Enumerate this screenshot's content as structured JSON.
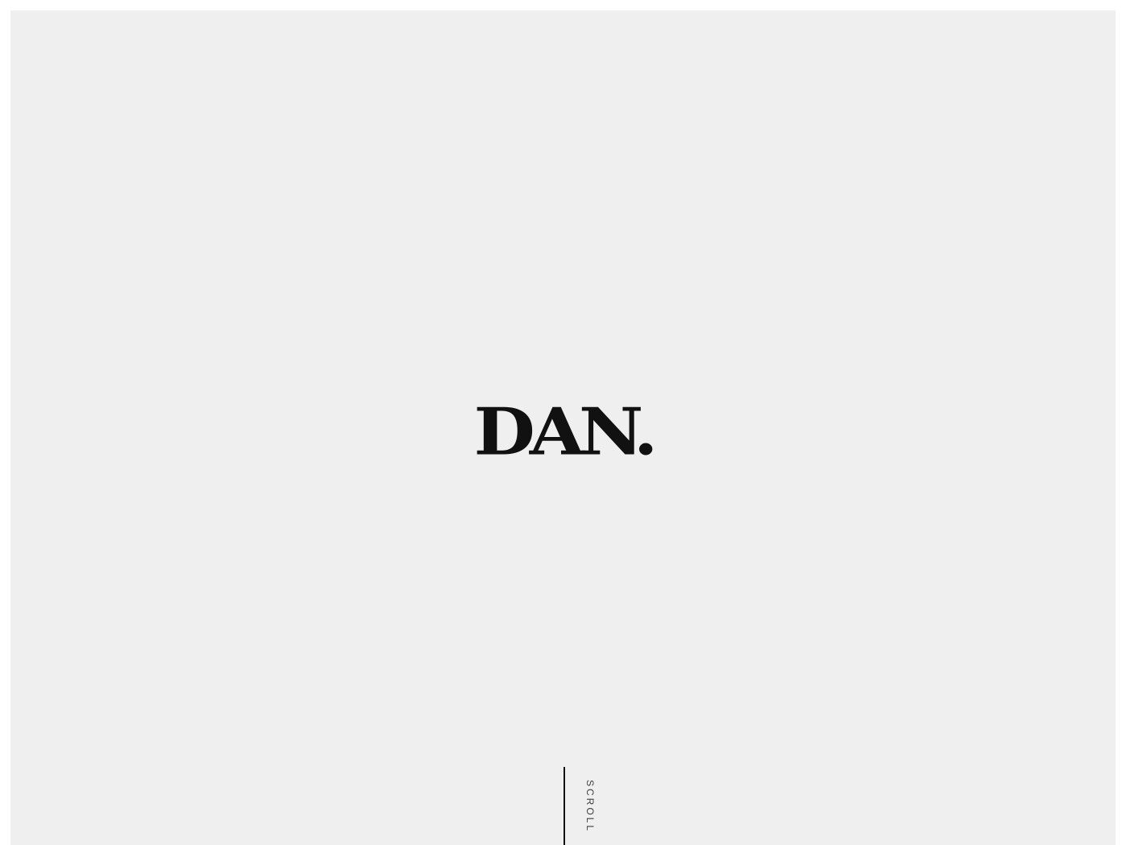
{
  "brand": {
    "logo_text": "DAN."
  },
  "scroll_indicator": {
    "label": "SCROLL"
  },
  "colors": {
    "background": "#efefef",
    "page_border": "#ffffff",
    "text": "#111111",
    "muted_text": "#3d3d3d"
  }
}
